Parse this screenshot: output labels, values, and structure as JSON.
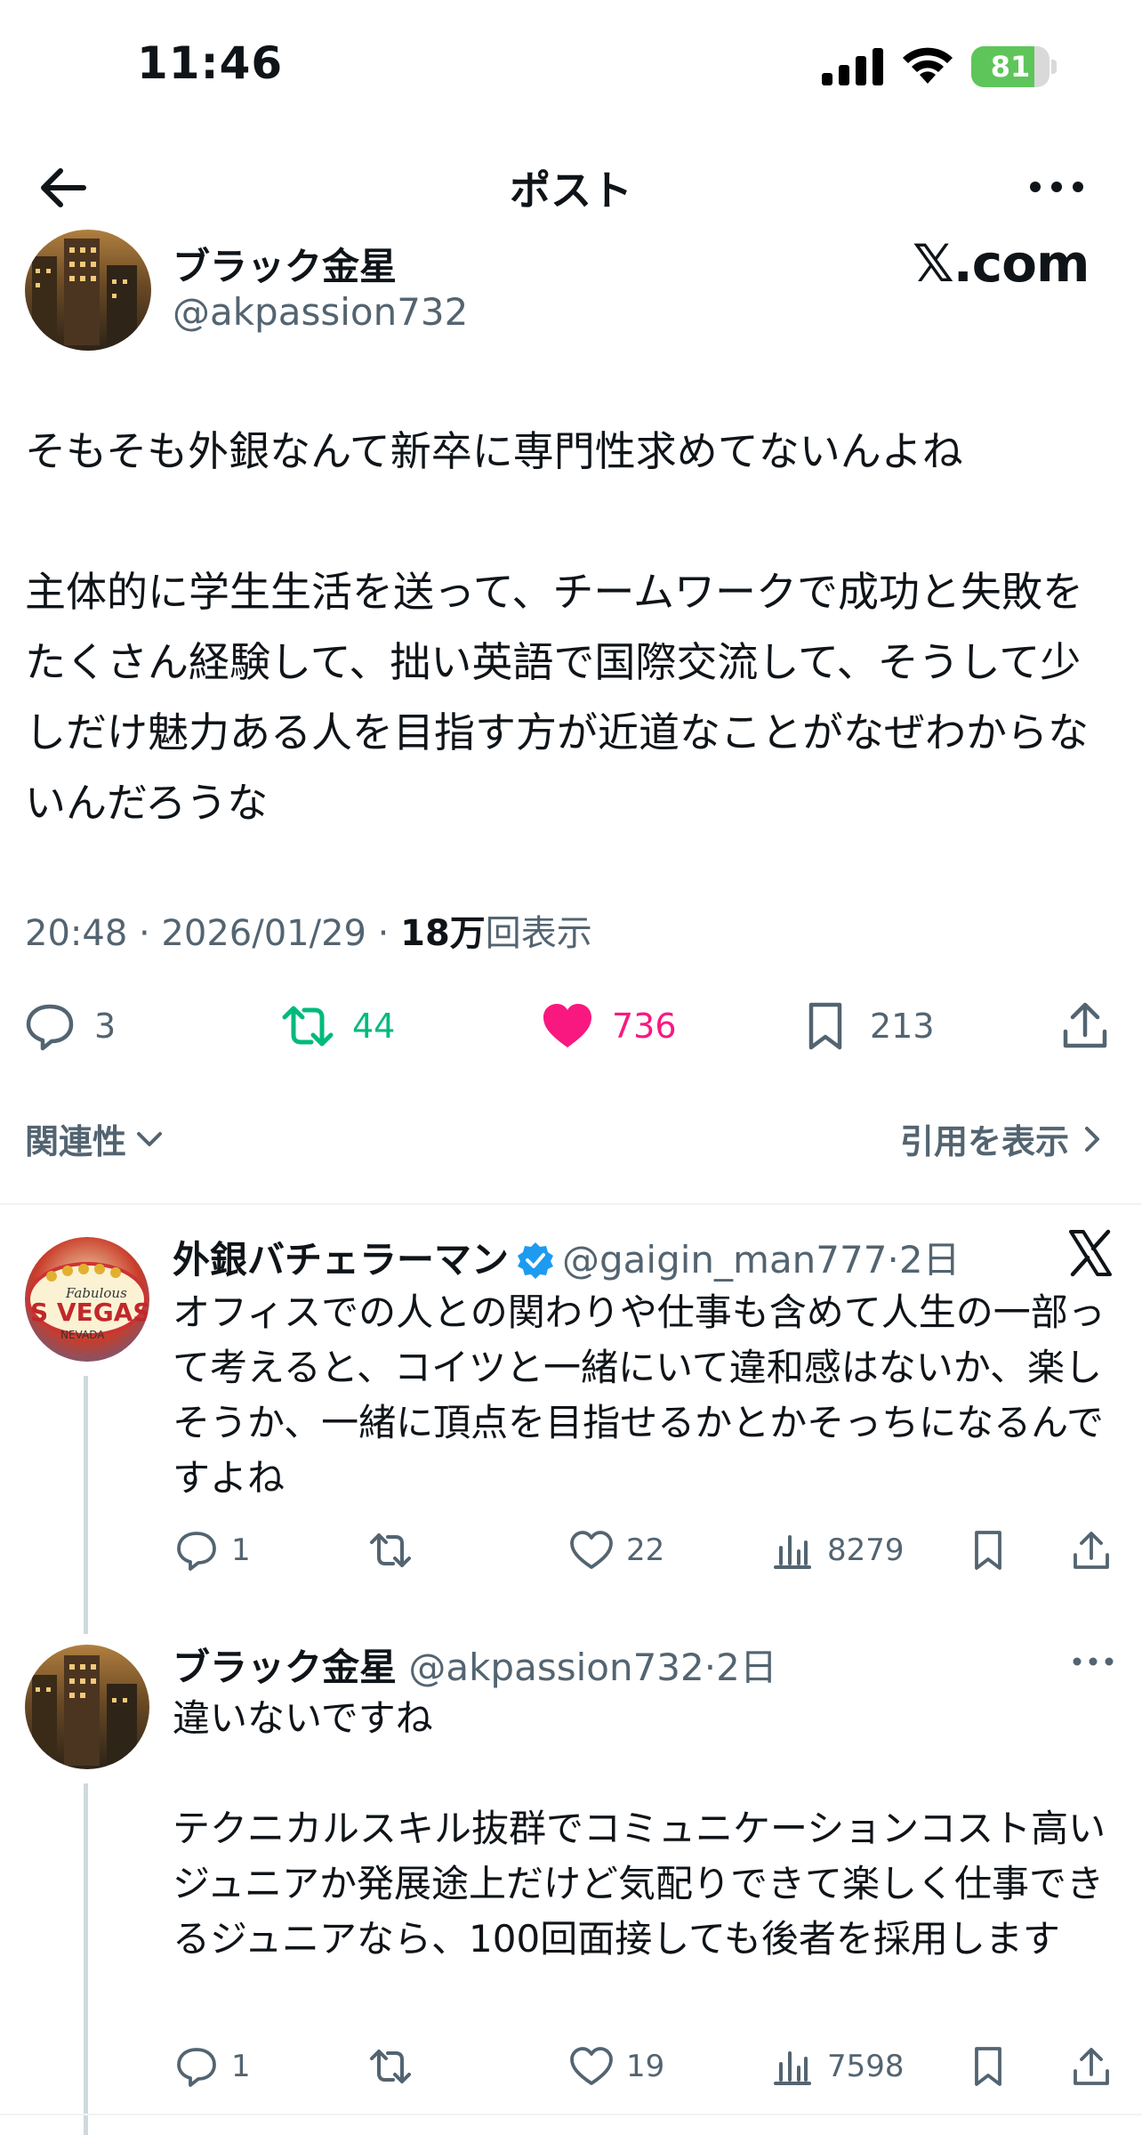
{
  "status_bar": {
    "time": "11:46",
    "battery": "81",
    "battery_level": 0.81
  },
  "nav": {
    "title": "ポスト"
  },
  "post": {
    "author_name": "ブラック金星",
    "author_handle": "@akpassion732",
    "brand": "𝕏.com",
    "text_p1": "そもそも外銀なんて新卒に専門性求めてないんよね",
    "text_p2": "主体的に学生生活を送って、チームワークで成功と失敗をたくさん経験して、拙い英語で国際交流して、そうして少しだけ魅力ある人を目指す方が近道なことがなぜわからないんだろうな",
    "time_date": "20:48 · 2026/01/29 · ",
    "views_count": "18万",
    "views_label": "回表示",
    "replies": "3",
    "reposts": "44",
    "likes": "736",
    "bookmarks": "213"
  },
  "sort": {
    "left_label": "関連性",
    "right_label": "引用を表示"
  },
  "replies": [
    {
      "name": "外銀バチェラーマン",
      "handle": "@gaigin_man777",
      "age": "·2日",
      "text": "オフィスでの人との関わりや仕事も含めて人生の一部って考えると、コイツと一緒にいて違和感はないか、楽しそうか、一緒に頂点を目指せるかとかそっちになるんですよね",
      "replies": "1",
      "reposts": "",
      "likes": "22",
      "views": "8279",
      "avatar_text": "Fabulous S VEGAS NEVADA"
    },
    {
      "name": "ブラック金星",
      "handle": "@akpassion732",
      "age": "·2日",
      "text_p1": "違いないですね",
      "text_p2": "テクニカルスキル抜群でコミュニケーションコスト高いジュニアか発展途上だけど気配りできて楽しく仕事できるジュニアなら、100回面接しても後者を採用します",
      "replies": "1",
      "reposts": "",
      "likes": "19",
      "views": "7598"
    }
  ],
  "colors": {
    "accent_like": "#f91880",
    "accent_repost": "#00ba7c",
    "muted": "#536471",
    "verified": "#1d9bf0"
  }
}
